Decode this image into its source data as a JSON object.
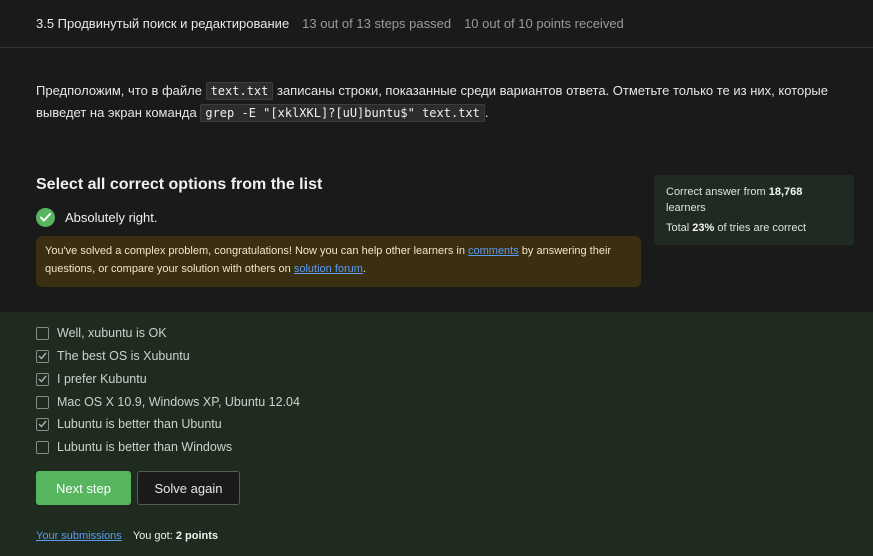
{
  "header": {
    "title": "3.5 Продвинутый поиск и редактирование",
    "steps": "13 out of 13 steps passed",
    "points": "10 out of 10 points  received"
  },
  "question": {
    "part1": "Предположим, что в файле ",
    "code1": "text.txt",
    "part2": " записаны строки, показанные среди вариантов ответа. Отметьте только те из них, которые выведет на экран команда ",
    "code2": "grep -E \"[xklXKL]?[uU]buntu$\" text.txt",
    "part3": "."
  },
  "quiz": {
    "title": "Select all correct options from the list",
    "result": "Absolutely right.",
    "notice_part1": "You've solved a complex problem, congratulations! Now you can help other learners in ",
    "notice_link1": "comments",
    "notice_part2": " by answering their questions, or compare your solution with others on ",
    "notice_link2": "solution forum",
    "notice_part3": "."
  },
  "stats": {
    "line1_prefix": "Correct answer from ",
    "learners_count": "18,768",
    "line1_suffix": " learners",
    "line2_prefix": "Total ",
    "percent": "23%",
    "line2_suffix": " of tries are correct"
  },
  "options": [
    {
      "label": "Well, xubuntu is OK",
      "checked": false
    },
    {
      "label": "The best OS is Xubuntu",
      "checked": true
    },
    {
      "label": "I prefer Kubuntu",
      "checked": true
    },
    {
      "label": "Mac OS X 10.9, Windows XP, Ubuntu 12.04",
      "checked": false
    },
    {
      "label": "Lubuntu is better than Ubuntu",
      "checked": true
    },
    {
      "label": "Lubuntu is better than Windows",
      "checked": false
    }
  ],
  "buttons": {
    "next": "Next step",
    "solve": "Solve again"
  },
  "footer": {
    "submissions": "Your submissions",
    "got_prefix": "You got: ",
    "got_value": "2 points"
  },
  "colors": {
    "accent_green": "#57b560",
    "link_blue": "#5b9bf0",
    "notice_bg": "#3a2f10"
  }
}
